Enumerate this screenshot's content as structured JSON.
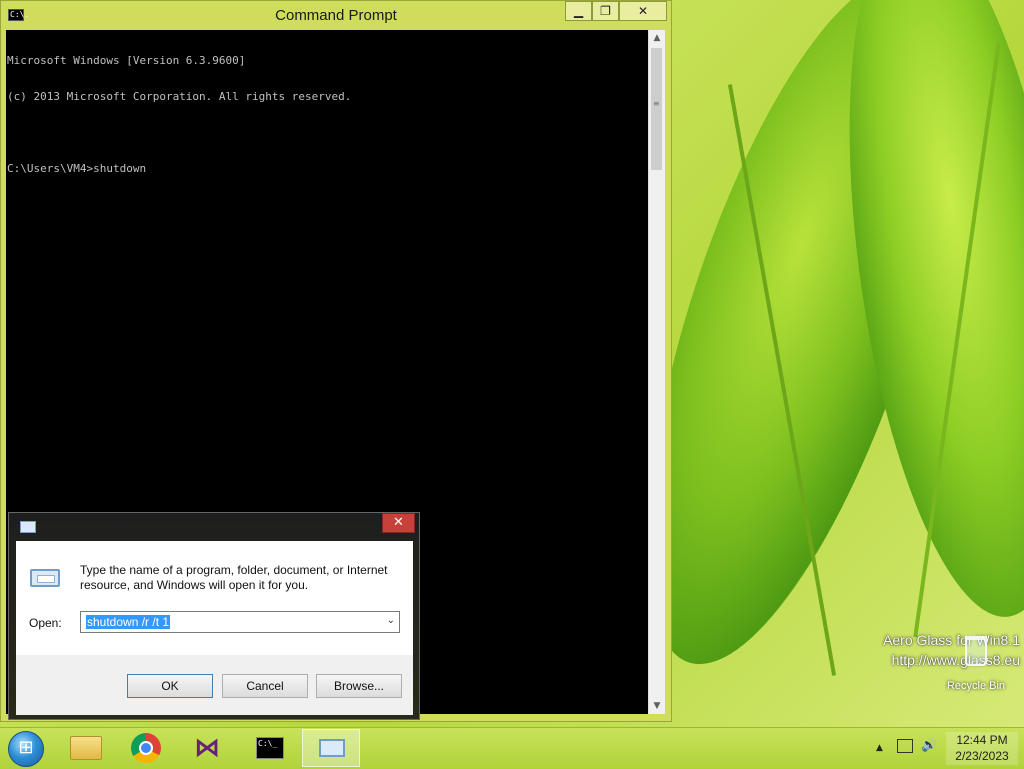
{
  "console": {
    "title": "Command Prompt",
    "icon_text": "C:\\.",
    "lines": [
      "Microsoft Windows [Version 6.3.9600]",
      "(c) 2013 Microsoft Corporation. All rights reserved.",
      "",
      "C:\\Users\\VM4>shutdown"
    ],
    "buttons": {
      "minimize": "▁",
      "maximize": "❐",
      "close": "✕"
    }
  },
  "run_dialog": {
    "description": "Type the name of a program, folder, document, or Internet resource, and Windows will open it for you.",
    "open_label": "Open:",
    "command_value": "shutdown /r /t 1",
    "close_glyph": "✕",
    "buttons": {
      "ok": "OK",
      "cancel": "Cancel",
      "browse": "Browse..."
    }
  },
  "desktop": {
    "watermark_line1": "Aero Glass for Win8.1",
    "watermark_line2": "http://www.glass8.eu",
    "recycle_bin_label": "Recycle Bin"
  },
  "taskbar": {
    "cmd_icon_text": "C:\\_",
    "clock_time": "12:44 PM",
    "clock_date": "2/23/2023",
    "tray_up_glyph": "▲",
    "volume_glyph": "🔊"
  },
  "icons": {
    "start": "windows-start-orb",
    "explorer": "folder-icon",
    "chrome": "chrome-icon",
    "visual_studio": "visual-studio-icon",
    "command_prompt": "cmd-icon",
    "run": "run-icon"
  }
}
